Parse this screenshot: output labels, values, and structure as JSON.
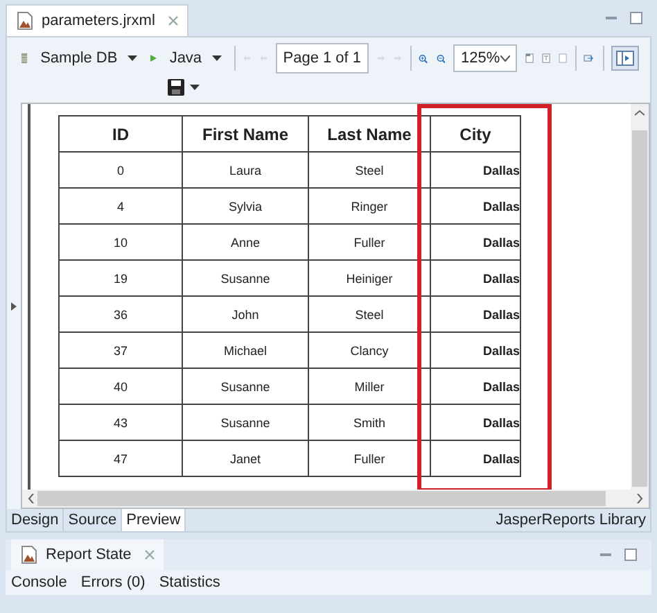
{
  "editor_tab": {
    "title": "parameters.jrxml"
  },
  "toolbar": {
    "data_adapter": "Sample DB",
    "language": "Java",
    "page_field": "Page 1 of 1",
    "zoom": "125%"
  },
  "table": {
    "columns": [
      "ID",
      "First Name",
      "Last Name",
      "City"
    ],
    "rows": [
      [
        "0",
        "Laura",
        "Steel",
        "Dallas"
      ],
      [
        "4",
        "Sylvia",
        "Ringer",
        "Dallas"
      ],
      [
        "10",
        "Anne",
        "Fuller",
        "Dallas"
      ],
      [
        "19",
        "Susanne",
        "Heiniger",
        "Dallas"
      ],
      [
        "36",
        "John",
        "Steel",
        "Dallas"
      ],
      [
        "37",
        "Michael",
        "Clancy",
        "Dallas"
      ],
      [
        "40",
        "Susanne",
        "Miller",
        "Dallas"
      ],
      [
        "43",
        "Susanne",
        "Smith",
        "Dallas"
      ],
      [
        "47",
        "Janet",
        "Fuller",
        "Dallas"
      ]
    ]
  },
  "bottom_tabs": [
    {
      "label": "Design",
      "selected": false
    },
    {
      "label": "Source",
      "selected": false
    },
    {
      "label": "Preview",
      "selected": true
    }
  ],
  "library_label": "JasperReports Library",
  "report_state": {
    "title": "Report State",
    "tabs": [
      {
        "label": "Console"
      },
      {
        "label": "Errors (0)"
      },
      {
        "label": "Statistics"
      }
    ]
  }
}
